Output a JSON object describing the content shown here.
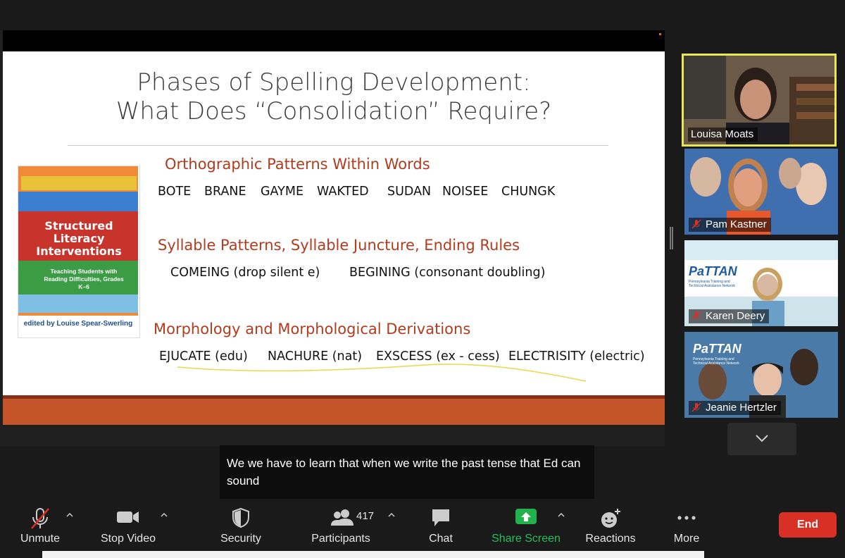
{
  "slide": {
    "title_line1": "Phases of Spelling Development:",
    "title_line2": "What Does “Consolidation” Require?",
    "section1": {
      "heading": "Orthographic Patterns Within Words",
      "words": [
        "BOTE",
        "BRANE",
        "GAYME",
        "WAKTED",
        "SUDAN",
        "NOISEE",
        "CHUNGK"
      ]
    },
    "section2": {
      "heading": "Syllable Patterns, Syllable Juncture, Ending Rules",
      "words": [
        "COMEING (drop silent e)",
        "BEGINING (consonant doubling)"
      ]
    },
    "section3": {
      "heading": "Morphology and Morphological Derivations",
      "words": [
        "EJUCATE (edu)",
        "NACHURE (nat)",
        "EXSCESS (ex - cess)",
        "ELECTRISITY (electric)"
      ]
    },
    "book": {
      "title": "Structured Literacy Interventions",
      "subtitle": "Teaching Students with Reading Difficulties, Grades K–6",
      "editor": "edited by Louise Spear-Swerling"
    }
  },
  "participants": [
    {
      "name": "Louisa Moats",
      "muted": false,
      "active_speaker": true
    },
    {
      "name": "Pam Kastner",
      "muted": true,
      "active_speaker": false
    },
    {
      "name": "Karen Deery",
      "muted": true,
      "active_speaker": false
    },
    {
      "name": "Jeanie Hertzler",
      "muted": true,
      "active_speaker": false
    }
  ],
  "caption": {
    "text": "We we have to learn that when we write the past tense that Ed can sound"
  },
  "toolbar": {
    "unmute": "Unmute",
    "stop_video": "Stop Video",
    "security": "Security",
    "participants": "Participants",
    "participant_count": "417",
    "chat": "Chat",
    "share_screen": "Share Screen",
    "reactions": "Reactions",
    "more": "More",
    "end": "End"
  },
  "colors": {
    "active_speaker_border": "#e8e65a",
    "share_screen_green": "#22b14c",
    "end_red": "#d93025",
    "slide_heading": "#b23b1e",
    "slide_footer": "#c4552a"
  }
}
